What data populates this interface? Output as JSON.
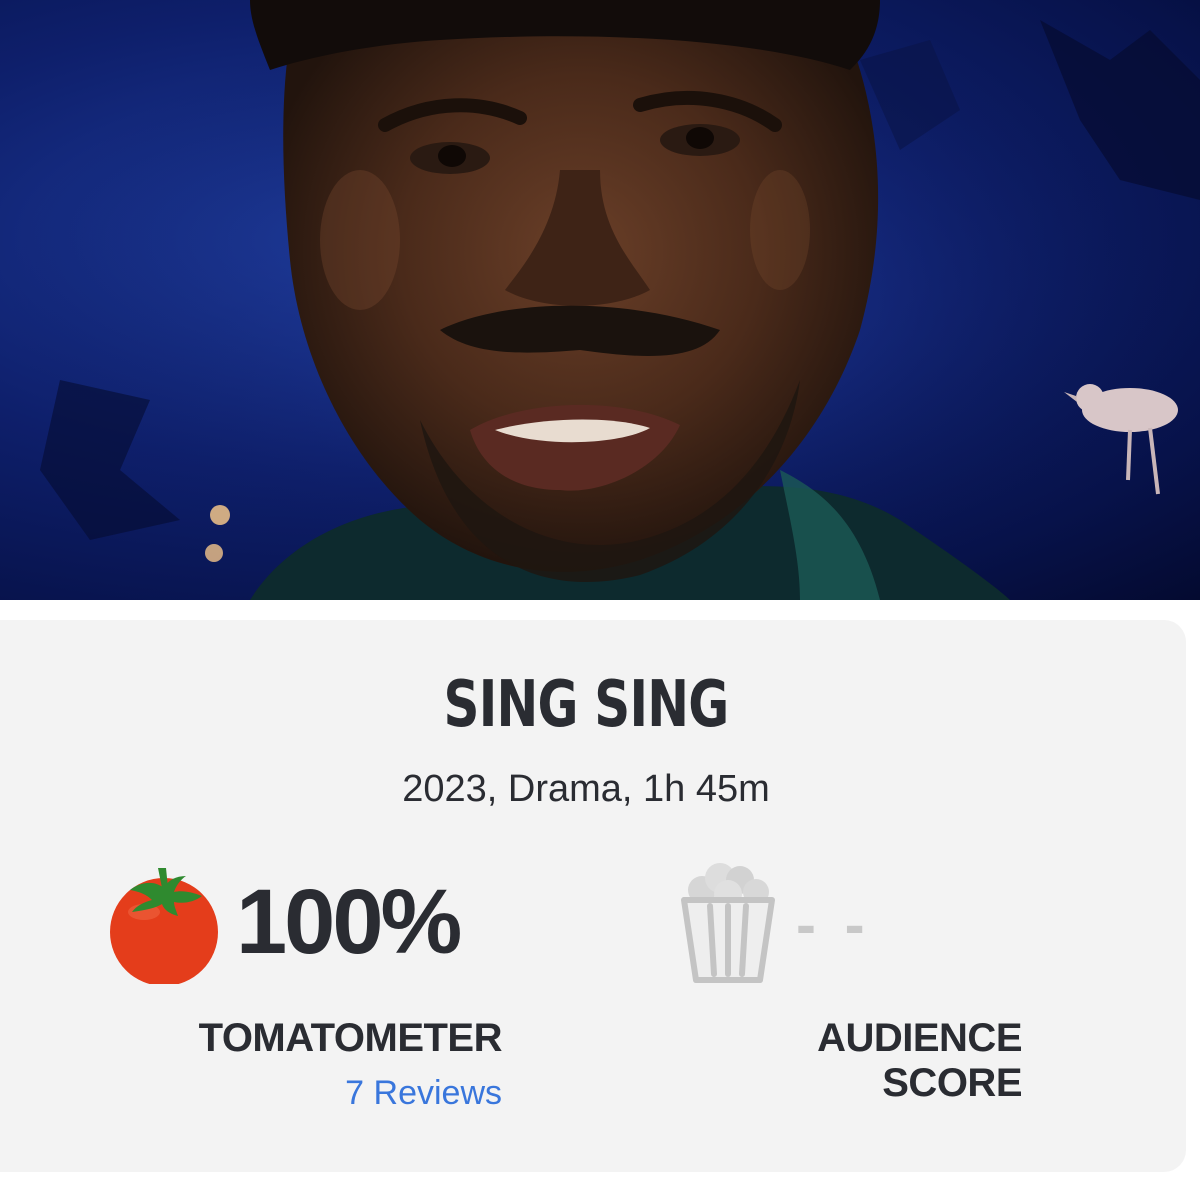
{
  "hero": {
    "image_icon": "movie-still-image"
  },
  "movie": {
    "title": "SING SING",
    "meta": "2023, Drama, 1h 45m"
  },
  "tomatometer": {
    "icon": "tomato-icon",
    "score": "100%",
    "label": "TOMATOMETER",
    "reviews_link": "7 Reviews"
  },
  "audience": {
    "icon": "popcorn-icon",
    "score": "- -",
    "label": "AUDIENCE SCORE"
  },
  "colors": {
    "title": "#2a2c32",
    "link": "#3976dc",
    "tomato_red": "#e43d1b",
    "tomato_leaf": "#2f8a2f",
    "placeholder_gray": "#c8c8c8",
    "card_bg": "#f3f3f3"
  }
}
